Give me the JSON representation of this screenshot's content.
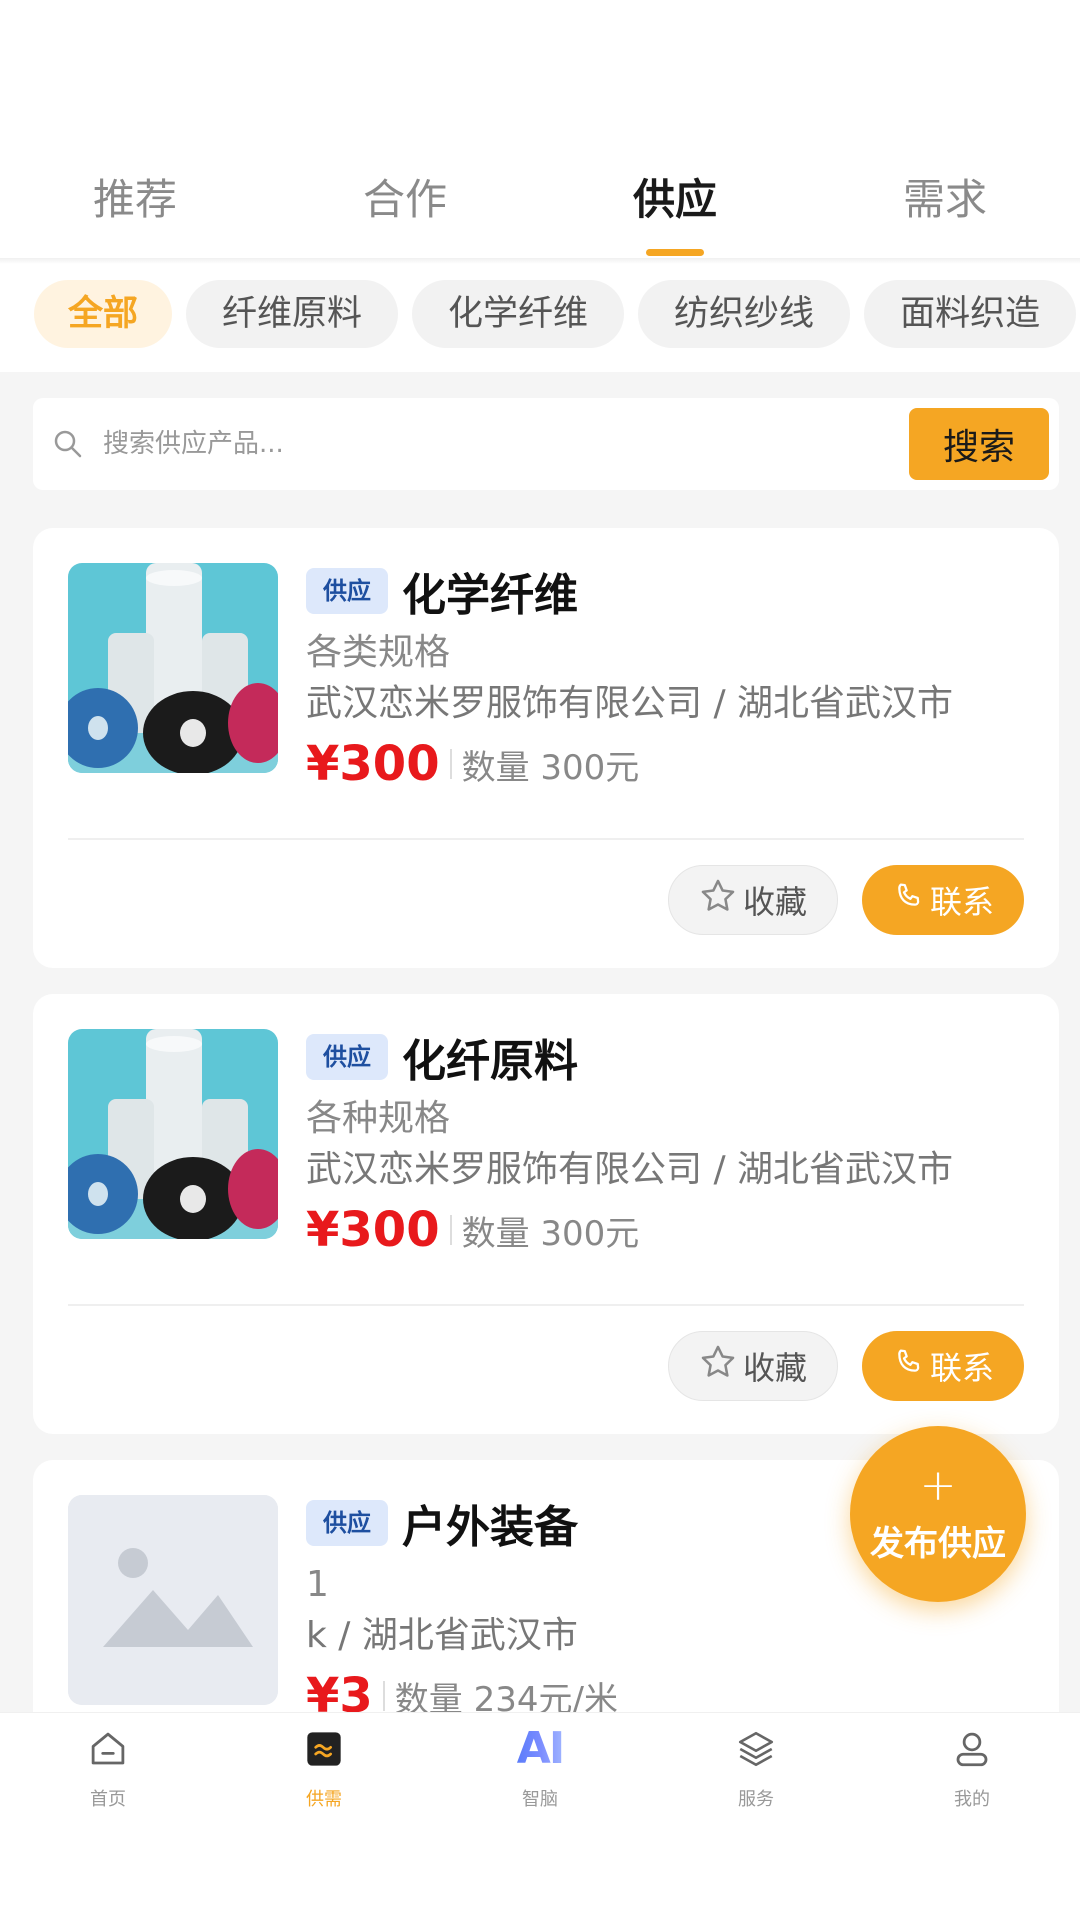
{
  "tabs": [
    {
      "label": "推荐"
    },
    {
      "label": "合作"
    },
    {
      "label": "供应"
    },
    {
      "label": "需求"
    }
  ],
  "active_tab": "供应",
  "categories": [
    {
      "label": "全部"
    },
    {
      "label": "纤维原料"
    },
    {
      "label": "化学纤维"
    },
    {
      "label": "纺织纱线"
    },
    {
      "label": "面料织造"
    }
  ],
  "search": {
    "placeholder": "搜索供应产品...",
    "button_label": "搜索"
  },
  "items": [
    {
      "badge": "供应",
      "title": "化学纤维",
      "spec": "各类规格",
      "company": "武汉恋米罗服饰有限公司 / 湖北省武汉市",
      "price": "¥300",
      "quantity": "数量 300元",
      "fav_label": "收藏",
      "contact_label": "联系"
    },
    {
      "badge": "供应",
      "title": "化纤原料",
      "spec": "各种规格",
      "company": "武汉恋米罗服饰有限公司 / 湖北省武汉市",
      "price": "¥300",
      "quantity": "数量 300元",
      "fav_label": "收藏",
      "contact_label": "联系"
    },
    {
      "badge": "供应",
      "title": "户外装备",
      "spec": "1",
      "company": "k / 湖北省武汉市",
      "price": "¥3",
      "quantity": "数量 234元/米"
    }
  ],
  "fab": {
    "plus": "+",
    "label": "发布供应"
  },
  "tabbar": [
    {
      "label": "首页",
      "icon": "home-icon"
    },
    {
      "label": "供需",
      "icon": "supply-demand-icon"
    },
    {
      "label": "智脑",
      "icon": "ai-icon",
      "icon_text": "AI"
    },
    {
      "label": "服务",
      "icon": "layers-icon"
    },
    {
      "label": "我的",
      "icon": "user-icon"
    }
  ],
  "colors": {
    "accent": "#f5a623",
    "price": "#e8191c",
    "badge_bg": "#dde8fb",
    "badge_text": "#1e4fa0"
  }
}
